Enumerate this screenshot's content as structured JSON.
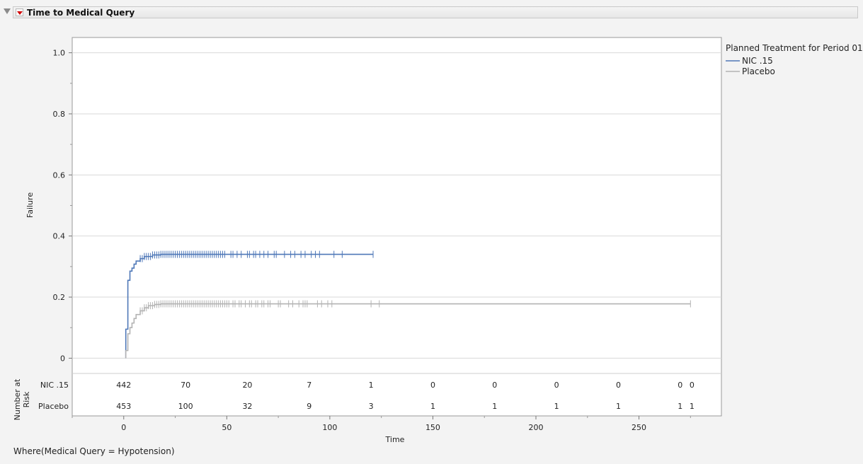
{
  "report": {
    "title": "Time to Medical Query",
    "where_clause": "Where(Medical Query = Hypotension)"
  },
  "chart_data": {
    "type": "line",
    "subtype": "step (Kaplan-Meier failure)",
    "xlabel": "Time",
    "ylabel": "Failure",
    "xlim": [
      -25,
      290
    ],
    "ylim": [
      -0.05,
      1.05
    ],
    "x_ticks": [
      0,
      50,
      100,
      150,
      200,
      250
    ],
    "y_ticks": [
      0,
      0.2,
      0.4,
      0.6,
      0.8,
      1.0
    ],
    "y_tick_labels": [
      "0",
      "0.2",
      "0.4",
      "0.6",
      "0.8",
      "1.0"
    ],
    "grid": "horizontal",
    "legend": {
      "title": "Planned Treatment for Period 01",
      "placement": "right"
    },
    "series": [
      {
        "name": "NIC .15",
        "color": "#4f78b8",
        "steps": [
          [
            1,
            0.095
          ],
          [
            2,
            0.255
          ],
          [
            3,
            0.285
          ],
          [
            4,
            0.295
          ],
          [
            5,
            0.308
          ],
          [
            6,
            0.318
          ],
          [
            8,
            0.326
          ],
          [
            10,
            0.333
          ],
          [
            14,
            0.338
          ],
          [
            18,
            0.34
          ],
          [
            121,
            0.34
          ]
        ],
        "censor_x": [
          8,
          9,
          10,
          11,
          12,
          13,
          14,
          15,
          16,
          17,
          18,
          19,
          20,
          21,
          22,
          23,
          24,
          25,
          26,
          27,
          28,
          29,
          30,
          31,
          32,
          33,
          34,
          35,
          36,
          37,
          38,
          39,
          40,
          41,
          42,
          43,
          44,
          45,
          46,
          47,
          48,
          49,
          52,
          53,
          55,
          57,
          60,
          61,
          63,
          64,
          66,
          68,
          70,
          73,
          74,
          78,
          81,
          83,
          86,
          88,
          91,
          93,
          95,
          102,
          106,
          121
        ]
      },
      {
        "name": "Placebo",
        "color": "#b3b3b3",
        "steps": [
          [
            1,
            0.025
          ],
          [
            2,
            0.08
          ],
          [
            3,
            0.1
          ],
          [
            4,
            0.115
          ],
          [
            5,
            0.13
          ],
          [
            6,
            0.143
          ],
          [
            8,
            0.155
          ],
          [
            10,
            0.165
          ],
          [
            12,
            0.172
          ],
          [
            15,
            0.176
          ],
          [
            18,
            0.178
          ],
          [
            275,
            0.178
          ]
        ],
        "censor_x": [
          8,
          9,
          10,
          11,
          12,
          13,
          14,
          15,
          16,
          17,
          18,
          19,
          20,
          21,
          22,
          23,
          24,
          25,
          26,
          27,
          28,
          29,
          30,
          31,
          32,
          33,
          34,
          35,
          36,
          37,
          38,
          39,
          40,
          41,
          42,
          43,
          44,
          45,
          46,
          47,
          48,
          49,
          50,
          51,
          53,
          54,
          56,
          57,
          59,
          61,
          62,
          64,
          65,
          67,
          68,
          70,
          71,
          75,
          76,
          80,
          82,
          85,
          87,
          88,
          89,
          94,
          96,
          99,
          101,
          120,
          124,
          275
        ]
      }
    ],
    "risk_table": {
      "label": "Number at Risk",
      "times": [
        0,
        30,
        60,
        90,
        120,
        150,
        180,
        210,
        240,
        270,
        275
      ],
      "rows": [
        {
          "name": "NIC .15",
          "values": [
            "442",
            "70",
            "20",
            "7",
            "1",
            "0",
            "0",
            "0",
            "0",
            "0",
            "0"
          ]
        },
        {
          "name": "Placebo",
          "values": [
            "453",
            "100",
            "32",
            "9",
            "3",
            "1",
            "1",
            "1",
            "1",
            "1",
            "1"
          ]
        }
      ]
    }
  }
}
